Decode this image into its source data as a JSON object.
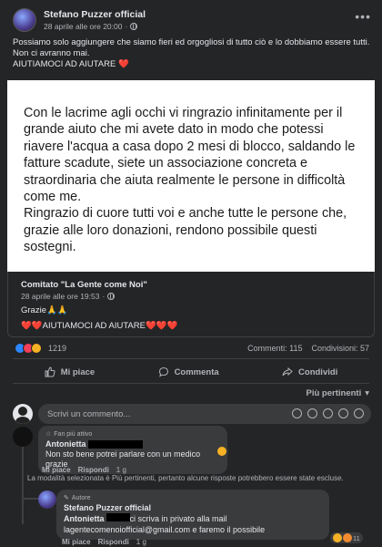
{
  "post": {
    "author": "Stefano Puzzer official",
    "timestamp": "28 aprile alle ore 20:00",
    "text_lines": [
      "Possiamo solo aggiungere che siamo fieri ed orgogliosi di tutto ciò e lo dobbiamo essere tutti.",
      "Non ci avranno mai.",
      "AIUTIAMOCI AD AIUTARE ❤️"
    ]
  },
  "shared_image": {
    "text": "Con le lacrime agli occhi vi ringrazio infinitamente per il grande aiuto che mi avete dato in modo che potessi riavere  l'acqua a casa dopo 2 mesi di blocco, saldando le fatture scadute, siete un associazione concreta e straordinaria che aiuta realmente le persone in difficoltà come me.\nRingrazio di cuore tutti voi e anche tutte le persone che, grazie alle loro donazioni, rendono possibile questi sostegni."
  },
  "shared_post": {
    "author": "Comitato \"La Gente come Noi\"",
    "timestamp": "28 aprile alle ore 19:53",
    "line1": "Grazie🙏🙏",
    "line2": "❤️❤️AIUTIAMOCI AD AIUTARE❤️❤️❤️"
  },
  "stats": {
    "reactions_count": "1219",
    "comments": "Commenti: 115",
    "shares": "Condivisioni: 57",
    "reaction_icons": [
      "like",
      "love",
      "care"
    ]
  },
  "actions": {
    "like": "Mi piace",
    "comment": "Commenta",
    "share": "Condividi"
  },
  "sort_label": "Più pertinenti",
  "comment_input": {
    "placeholder": "Scrivi un commento..."
  },
  "comments": [
    {
      "badge": "Fan più attivo",
      "author": "Antonietta",
      "text": "Non sto bene potrei parlare con un medico grazie",
      "like": "Mi piace",
      "reply": "Rispondi",
      "time": "1 g"
    }
  ],
  "notice": "La modalità selezionata è Più pertinenti, pertanto alcune risposte potrebbero essere state escluse.",
  "reply": {
    "badge": "Autore",
    "author": "Stefano Puzzer official",
    "mention": "Antonietta",
    "text_1": "ci scriva in privato alla mail",
    "text_2": "lagentecomenoiofficial@gmail.com e faremo il possibile",
    "like": "Mi piace",
    "reply": "Rispondi",
    "time": "1 g",
    "reaction_count": "11"
  },
  "colors": {
    "background": "#242526",
    "bubble": "#3a3b3c",
    "text": "#e4e6eb",
    "secondary_text": "#b0b3b8",
    "like_blue": "#2d88ff",
    "love_red": "#f33e58"
  }
}
